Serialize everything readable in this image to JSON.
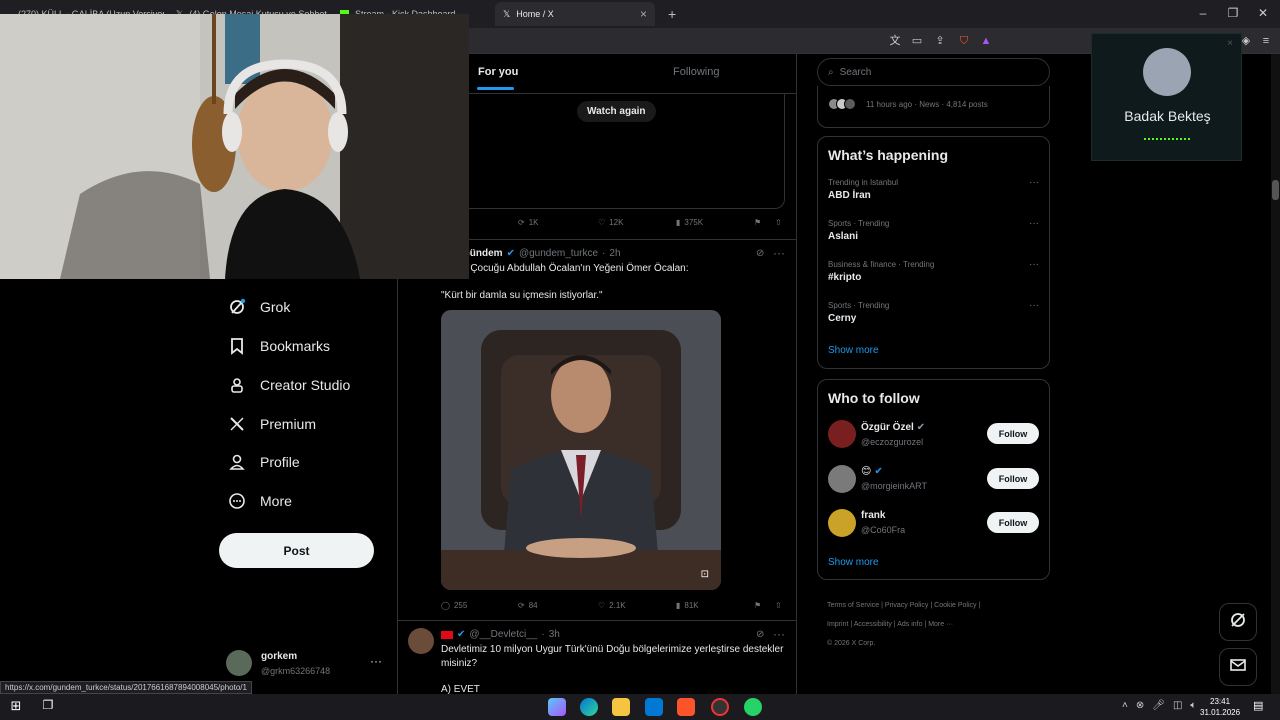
{
  "browser": {
    "tabs": [
      {
        "label": "(270) KÜLL - GALİBA (Uzun Versiyon)"
      },
      {
        "label": "(4) Gelen Mesaj Kutusu ve Sohbet"
      },
      {
        "label": "Stream - Kick Dashboard"
      },
      {
        "label": "Home / X"
      }
    ],
    "status_url": "https://x.com/gundem_turkce/status/2017661687894008045/photo/1"
  },
  "feed": {
    "tabs": [
      "For you",
      "Following"
    ],
    "watch_again": "Watch again",
    "top_post_stats": {
      "retweets": "1K",
      "likes": "12K",
      "views": "375K"
    },
    "post": {
      "author": "Gündem",
      "handle": "@gundem_turkce",
      "time": "2h",
      "line1": "u Çocuğu Abdullah Öcalan'ın Yeğeni Ömer Öcalan:",
      "quote": "\"Kürt bir damla su içmesin istiyorlar.\"",
      "replies": "255",
      "retweets": "84",
      "likes": "2.1K",
      "views": "81K"
    },
    "post2": {
      "handle": "@__Devletci__",
      "time": "3h",
      "text": "Devletimiz 10 milyon Uygur Türk'ünü Doğu bölgelerimize yerleştirse destekler misiniz?",
      "option_a": "A) EVET"
    }
  },
  "nav": {
    "items": [
      {
        "label": "Grok",
        "icon": "grok-icon"
      },
      {
        "label": "Bookmarks",
        "icon": "bookmark-icon"
      },
      {
        "label": "Creator Studio",
        "icon": "creator-studio-icon"
      },
      {
        "label": "Premium",
        "icon": "x-logo-icon"
      },
      {
        "label": "Profile",
        "icon": "person-icon"
      },
      {
        "label": "More",
        "icon": "more-circle-icon"
      }
    ],
    "post_button": "Post",
    "account": {
      "name": "gorkem",
      "handle": "@grkm63266748"
    }
  },
  "right": {
    "search_placeholder": "Search",
    "event_meta": "11 hours ago · News · 4,814 posts",
    "happening_title": "What’s happening",
    "trends": [
      {
        "meta": "Trending in Istanbul",
        "title": "ABD İran"
      },
      {
        "meta": "Sports · Trending",
        "title": "Aslani"
      },
      {
        "meta": "Business & finance · Trending",
        "title": "#kripto"
      },
      {
        "meta": "Sports · Trending",
        "title": "Cerny"
      }
    ],
    "show_more": "Show more",
    "who_to_follow_title": "Who to follow",
    "follow_suggestions": [
      {
        "name": "Özgür Özel",
        "handle": "@eczozgurozel"
      },
      {
        "name": "😊",
        "handle": "@morgieinkART"
      },
      {
        "name": "frank",
        "handle": "@Co60Fra"
      }
    ],
    "follow_label": "Follow",
    "show_more_2": "Show more",
    "footer": [
      "Terms of Service",
      "Privacy Policy",
      "Cookie Policy",
      "Imprint",
      "Accessibility",
      "Ads info",
      "More ···"
    ],
    "copyright": "© 2026 X Corp."
  },
  "overlay": {
    "name": "Badak Bekteş"
  },
  "taskbar": {
    "time": "23:41",
    "date": "31.01.2026"
  },
  "colors": {
    "accent": "#1d9bf0",
    "background": "#000000",
    "border": "#2f3336",
    "muted": "#71767b"
  }
}
